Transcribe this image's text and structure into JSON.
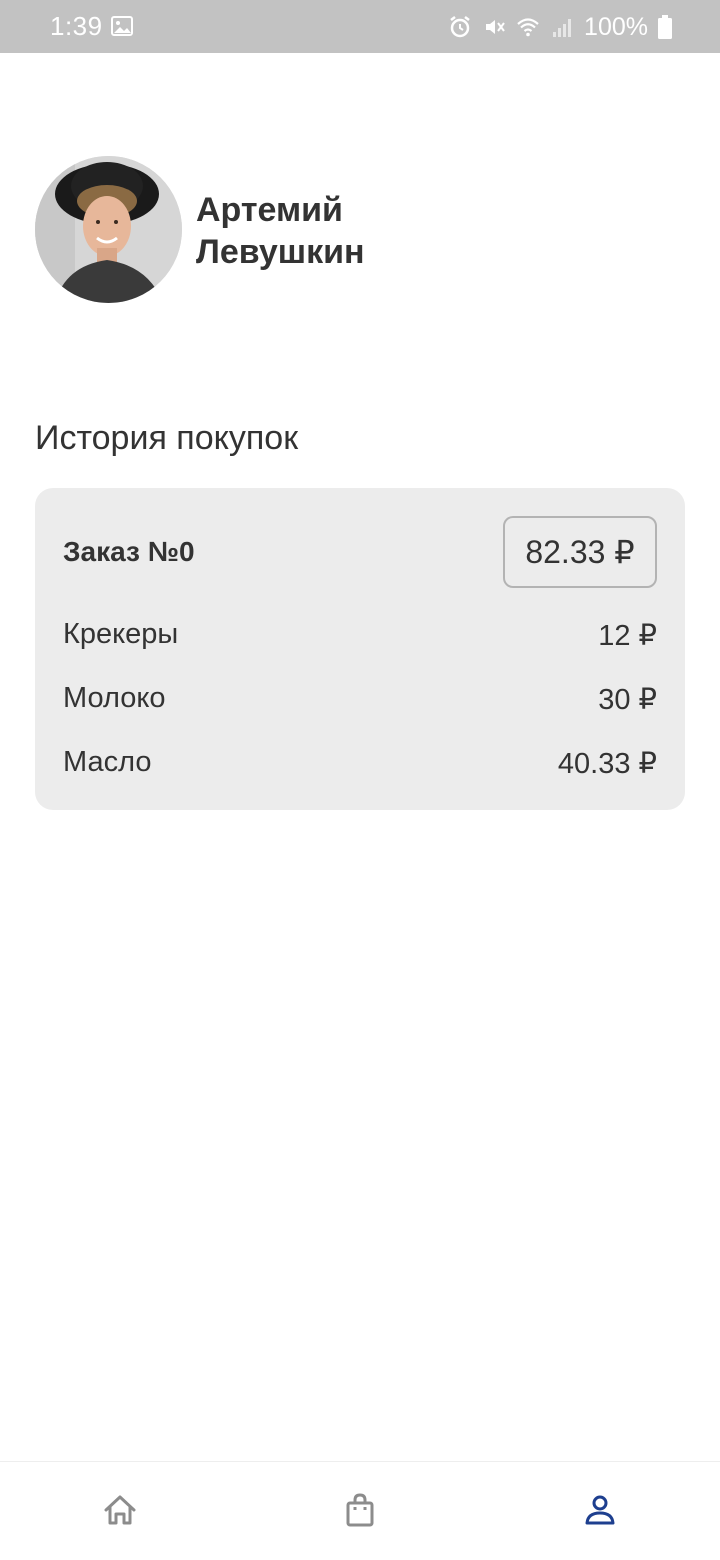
{
  "status_bar": {
    "time": "1:39",
    "battery_percent": "100%",
    "icons": [
      "image-icon",
      "alarm-icon",
      "mute-icon",
      "wifi-icon",
      "signal-icon",
      "battery-icon"
    ]
  },
  "profile": {
    "name_line1": "Артемий",
    "name_line2": "Левушкин"
  },
  "history": {
    "title": "История покупок",
    "orders": [
      {
        "title": "Заказ №0",
        "total": "82.33 ₽",
        "items": [
          {
            "name": "Крекеры",
            "price": "12 ₽"
          },
          {
            "name": "Молоко",
            "price": "30 ₽"
          },
          {
            "name": "Масло",
            "price": "40.33 ₽"
          }
        ]
      }
    ]
  },
  "nav": {
    "items": [
      {
        "icon": "home-icon",
        "active": false
      },
      {
        "icon": "shopping-bag-icon",
        "active": false
      },
      {
        "icon": "profile-icon",
        "active": true
      }
    ],
    "active_color": "#1e3f8f",
    "inactive_color": "#8c8c8c"
  }
}
